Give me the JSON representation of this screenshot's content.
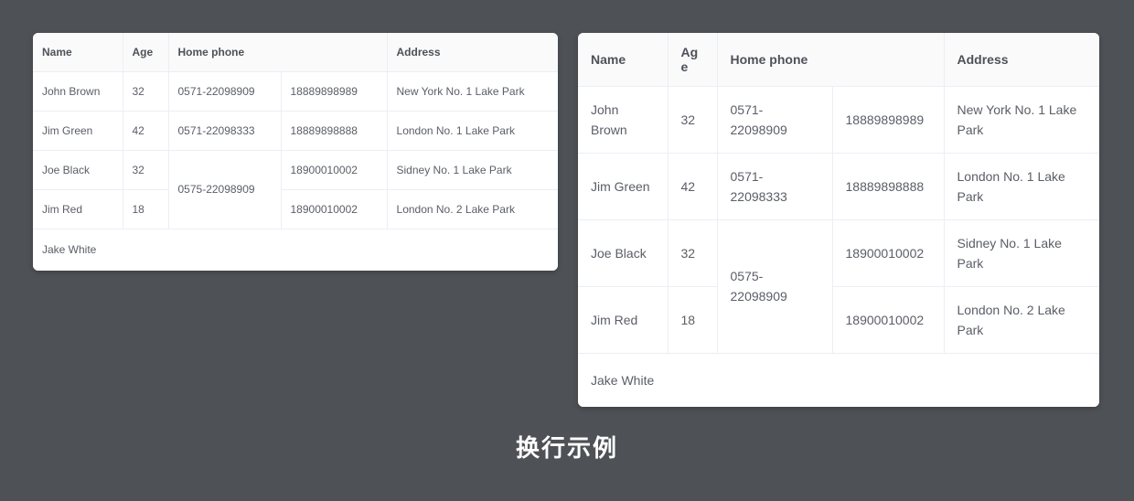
{
  "theme": {
    "background": "#4e5155",
    "card_background": "#ffffff",
    "header_background": "#fafafa",
    "border_color": "#ebeef5",
    "link_color": "#409eff",
    "text_color": "#5a5e66",
    "caption_color": "#ffffff"
  },
  "caption": "换行示例",
  "tables": [
    {
      "id": "compact-table",
      "headers": {
        "name": "Name",
        "age": "Age",
        "home_phone": "Home phone",
        "address": "Address"
      },
      "rows": [
        {
          "name": "John Brown",
          "age": "32",
          "phone1": "0571-22098909",
          "phone2": "18889898989",
          "address": "New York No. 1 Lake Park"
        },
        {
          "name": "Jim Green",
          "age": "42",
          "phone1": "0571-22098333",
          "phone2": "18889898888",
          "address": "London No. 1 Lake Park"
        },
        {
          "name": "Joe Black",
          "age": "32",
          "phone1": "0575-22098909",
          "phone2": "18900010002",
          "address": "Sidney No. 1 Lake Park"
        },
        {
          "name": "Jim Red",
          "age": "18",
          "phone1": "",
          "phone2": "18900010002",
          "address": "London No. 2 Lake Park"
        }
      ],
      "merged_phone": "0575-22098909",
      "footer": {
        "name": "Jake White"
      }
    },
    {
      "id": "wrapping-table",
      "headers": {
        "name": "Name",
        "age": "Age",
        "home_phone": "Home phone",
        "address": "Address"
      },
      "rows": [
        {
          "name": "John Brown",
          "age": "32",
          "phone1": "0571-22098909",
          "phone2": "18889898989",
          "address": "New York No. 1 Lake Park"
        },
        {
          "name": "Jim Green",
          "age": "42",
          "phone1": "0571-22098333",
          "phone2": "18889898888",
          "address": "London No. 1 Lake Park"
        },
        {
          "name": "Joe Black",
          "age": "32",
          "phone1": "0575-22098909",
          "phone2": "18900010002",
          "address": "Sidney No. 1 Lake Park"
        },
        {
          "name": "Jim Red",
          "age": "18",
          "phone1": "",
          "phone2": "18900010002",
          "address": "London No. 2 Lake Park"
        }
      ],
      "merged_phone": "0575-22098909",
      "footer": {
        "name": "Jake White"
      }
    }
  ]
}
